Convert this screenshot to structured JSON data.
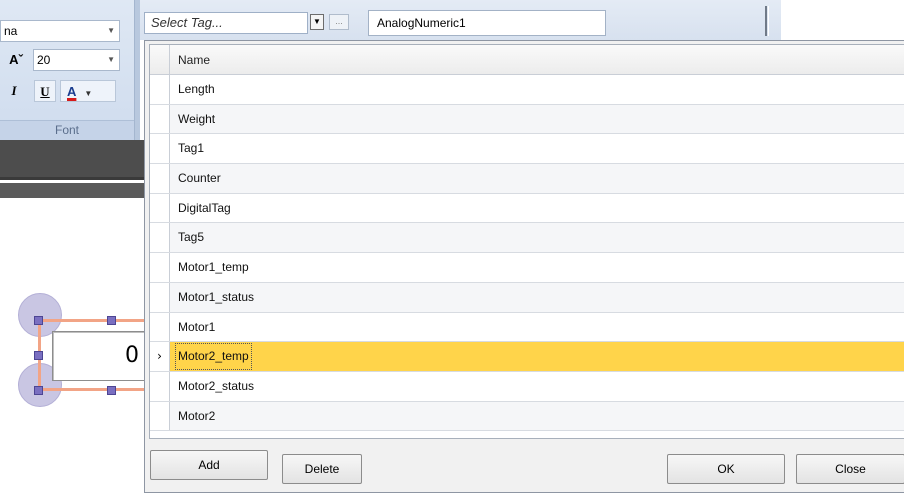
{
  "ribbon": {
    "font_name": "na",
    "font_size": "20",
    "grow_glyph": "Aˇ",
    "italic_label": "I",
    "underline_label": "U",
    "color_letter": "A",
    "group_label": "Font"
  },
  "toolbar": {
    "tag_placeholder": "Select Tag...",
    "ellipsis_label": "...",
    "object_name": "AnalogNumeric1"
  },
  "canvas": {
    "value_display": "0"
  },
  "tag_list": {
    "column_header": "Name",
    "selected_indicator": "›",
    "rows": [
      {
        "name": "Length"
      },
      {
        "name": "Weight"
      },
      {
        "name": "Tag1"
      },
      {
        "name": "Counter"
      },
      {
        "name": "DigitalTag"
      },
      {
        "name": "Tag5"
      },
      {
        "name": "Motor1_temp"
      },
      {
        "name": "Motor1_status"
      },
      {
        "name": "Motor1"
      },
      {
        "name": "Motor2_temp"
      },
      {
        "name": "Motor2_status"
      },
      {
        "name": "Motor2"
      }
    ]
  },
  "buttons": {
    "add": "Add",
    "delete": "Delete",
    "ok": "OK",
    "close": "Close"
  },
  "colors": {
    "selection_highlight": "#ffd44a",
    "handle": "#7a6fc1",
    "selection_border": "#f2a486"
  }
}
